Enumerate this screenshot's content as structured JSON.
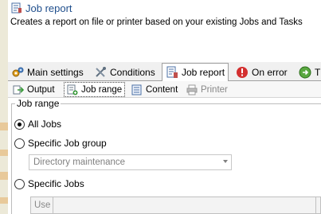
{
  "header": {
    "title": "Job report",
    "description": "Creates a report on file or printer based on your existing Jobs and Tasks"
  },
  "tabs": [
    {
      "label": "Main settings",
      "icon": "gears-icon"
    },
    {
      "label": "Conditions",
      "icon": "tools-icon"
    },
    {
      "label": "Job report",
      "icon": "report-icon",
      "active": true
    },
    {
      "label": "On error",
      "icon": "error-icon"
    },
    {
      "label": "T",
      "icon": "retry-icon"
    }
  ],
  "subtabs": [
    {
      "label": "Output",
      "icon": "output-icon"
    },
    {
      "label": "Job range",
      "icon": "job-range-icon",
      "active": true
    },
    {
      "label": "Content",
      "icon": "content-icon"
    },
    {
      "label": "Printer",
      "icon": "printer-icon",
      "disabled": true
    }
  ],
  "job_range": {
    "legend": "Job range",
    "options": [
      {
        "label": "All Jobs",
        "checked": true
      },
      {
        "label": "Specific Job group",
        "checked": false
      },
      {
        "label": "Specific Jobs",
        "checked": false
      }
    ],
    "group_select": {
      "value": "Directory maintenance"
    },
    "grid_columns": [
      "Use",
      ""
    ]
  },
  "colors": {
    "title": "#1f4e8c",
    "error_red": "#d32f2f",
    "strip": "#ece9d8"
  }
}
